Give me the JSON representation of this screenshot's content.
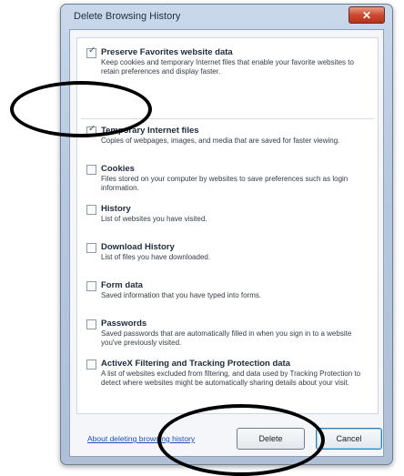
{
  "window": {
    "title": "Delete Browsing History",
    "close_label": "✕"
  },
  "options": [
    {
      "title": "Preserve Favorites website data",
      "description": "Keep cookies and temporary Internet files that enable your favorite websites to retain preferences and display faster.",
      "checked": true
    },
    {
      "title": "Temporary Internet files",
      "description": "Copies of webpages, images, and media that are saved for faster viewing.",
      "checked": true
    },
    {
      "title": "Cookies",
      "description": "Files stored on your computer by websites to save preferences such as login information.",
      "checked": false
    },
    {
      "title": "History",
      "description": "List of websites you have visited.",
      "checked": false
    },
    {
      "title": "Download History",
      "description": "List of files you have downloaded.",
      "checked": false
    },
    {
      "title": "Form data",
      "description": "Saved information that you have typed into forms.",
      "checked": false
    },
    {
      "title": "Passwords",
      "description": "Saved passwords that are automatically filled in when you sign in to a website you've previously visited.",
      "checked": false
    },
    {
      "title": "ActiveX Filtering and Tracking Protection data",
      "description": "A list of websites excluded from filtering, and data used by Tracking Protection to detect where websites might be automatically sharing details about your visit.",
      "checked": false
    }
  ],
  "footer": {
    "link_label": "About deleting browsing history",
    "delete_label": "Delete",
    "cancel_label": "Cancel"
  },
  "colors": {
    "close_button": "#cc4a2f",
    "annotation_ring": "#000000",
    "link": "#1e4fb4"
  },
  "icons": {
    "checkmark": "check-icon",
    "close": "close-icon"
  }
}
